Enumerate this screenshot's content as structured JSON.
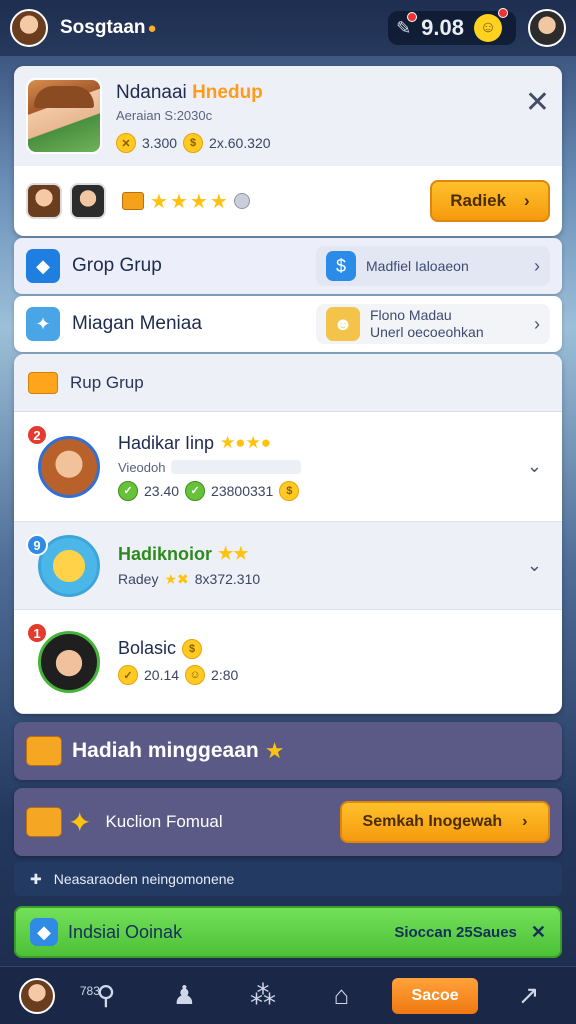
{
  "topbar": {
    "player_name": "Sosgtaan",
    "currency_value": "9.08"
  },
  "profile": {
    "name_main": "Ndanaai ",
    "name_highlight": "Hnedup",
    "subtitle": "Aeraian S:2030c",
    "stat_a": "3.300",
    "stat_b": "2x.60.320",
    "star_count": 4,
    "claim_button": "Radiek"
  },
  "rows": [
    {
      "label": "Grop Grup",
      "chip_text": "Madfiel Ialoaeon"
    },
    {
      "label": "Miagan Meniaa",
      "chip_line1": "Flono Madau",
      "chip_line2": "Unerl oecoeohkan"
    }
  ],
  "list": {
    "header": "Rup Grup",
    "entries": [
      {
        "rank": "2",
        "name": "Hadikar Iinp",
        "sub": "Vieodoh",
        "stat_a": "23.40",
        "stat_b": "23800331"
      },
      {
        "rank": "9",
        "name": "Hadiknoior",
        "sub": "Radey",
        "stat_b": "8x372.310"
      },
      {
        "rank": "1",
        "name": "Bolasic",
        "stat_a": "20.14",
        "stat_b": "2:80"
      }
    ]
  },
  "weekly_bar": {
    "title": "Hadiah minggeaan"
  },
  "festival_bar": {
    "label": "Kuclion Fomual",
    "button": "Semkah Inogewah"
  },
  "notice": {
    "text": "Neasaraoden neingomonene"
  },
  "green_bar": {
    "label": "Indsiai Ooinak",
    "right": "Sioccan 25Saues"
  },
  "bottom_nav": {
    "count": "783",
    "button": "Sacoe"
  },
  "colors": {
    "accent_orange": "#f59a0e",
    "panel_purple": "#5b5a86",
    "green": "#4cc138"
  },
  "icons": [
    "avatar-icon",
    "flame-icon",
    "wrench-icon",
    "coin-icon",
    "close-icon",
    "star-icon",
    "chest-icon",
    "cube-icon",
    "map-icon",
    "chevron-right-icon",
    "chevron-down-icon",
    "gift-icon",
    "puzzle-icon",
    "search-icon",
    "user-icon",
    "grid-icon",
    "home-icon",
    "arrow-icon"
  ]
}
